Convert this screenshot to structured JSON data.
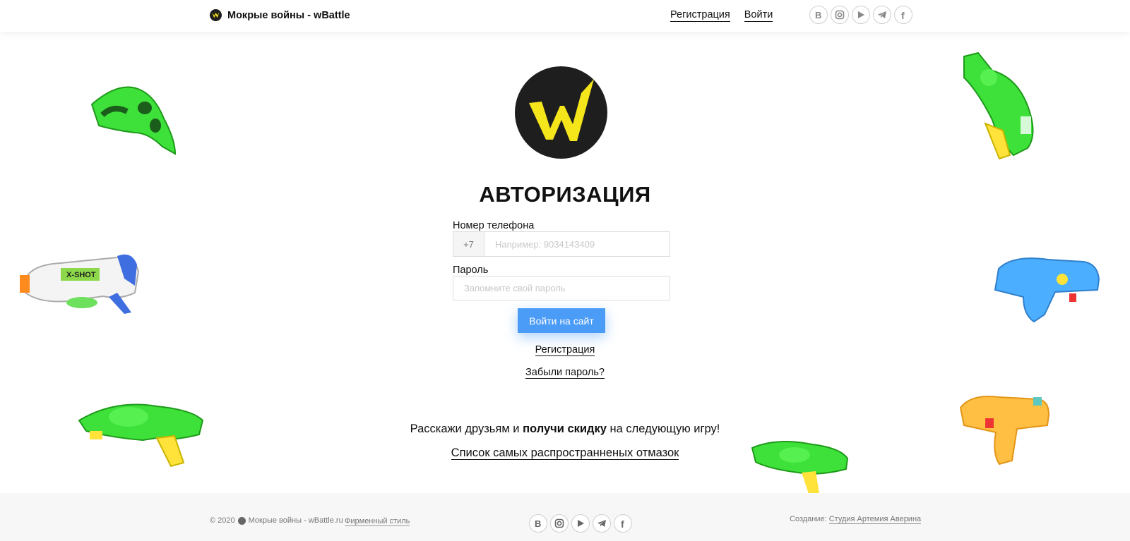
{
  "header": {
    "title": "Мокрые войны - wBattle",
    "nav": {
      "register": "Регистрация",
      "login": "Войти"
    },
    "socials": [
      "vk-icon",
      "instagram-icon",
      "youtube-icon",
      "telegram-icon",
      "facebook-icon"
    ]
  },
  "main": {
    "title": "АВТОРИЗАЦИЯ",
    "phone": {
      "label": "Номер телефона",
      "prefix": "+7",
      "placeholder": "Например: 9034143409"
    },
    "password": {
      "label": "Пароль",
      "placeholder": "Запомните свой пароль"
    },
    "login_button": "Войти на сайт",
    "register_link": "Регистрация",
    "forgot_link": "Забыли пароль?",
    "promo": {
      "before": "Расскажи друзьям и ",
      "bold": "получи скидку",
      "after": " на следующую игру!"
    },
    "excuses_link": "Список самых распространненых отмазок"
  },
  "footer": {
    "copyright_year": "© 2020",
    "copyright_text": "Мокрые войны - wBattle.ru",
    "brand_style_link": "Фирменный стиль",
    "creator_label": "Создание:",
    "creator_link": "Студия Артемия Аверина"
  },
  "colors": {
    "accent": "#4b9cf7",
    "logo_yellow": "#f5e51b",
    "logo_dark": "#1e1e1e"
  }
}
